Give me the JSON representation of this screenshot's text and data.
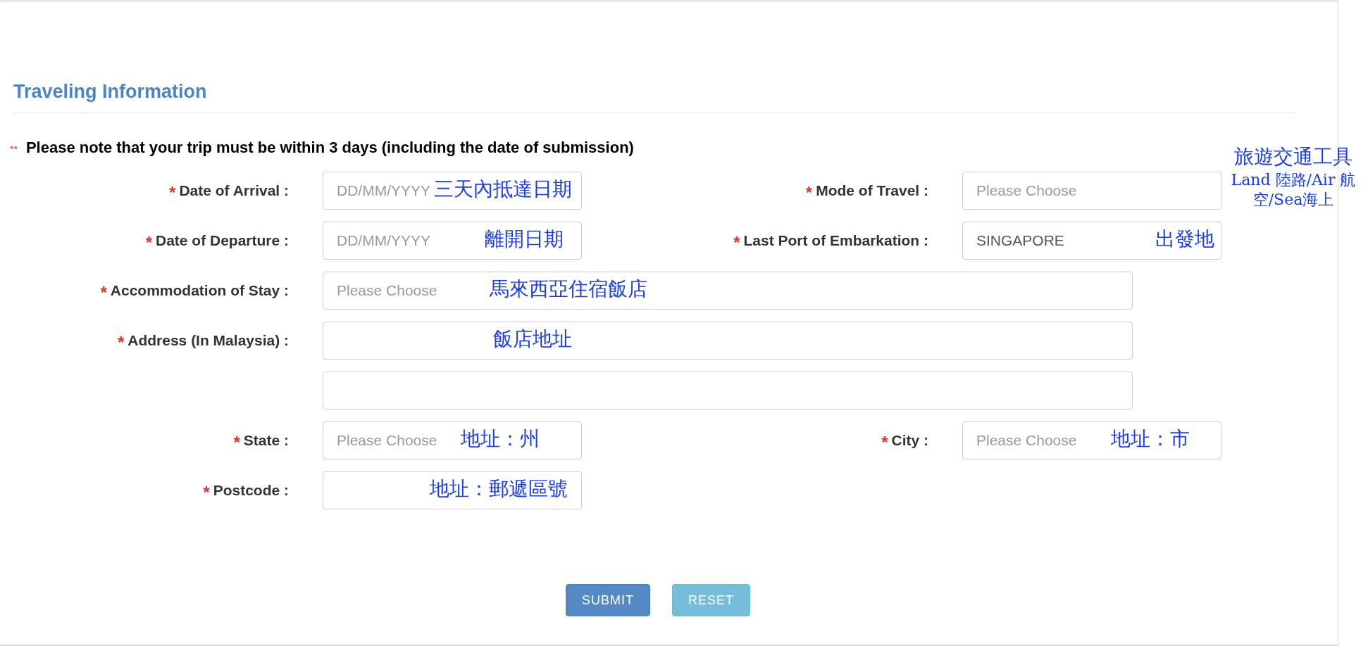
{
  "section": {
    "title": "Traveling Information"
  },
  "note": {
    "marker": "**",
    "text": "Please note that your trip must be within 3 days (including the date of submission)"
  },
  "rows": [
    {
      "fields": [
        {
          "marker": "*",
          "label": "Date of Arrival :",
          "placeholder": "DD/MM/YYYY",
          "annotations": [
            "三天內抵達日期"
          ]
        },
        {
          "marker": "*",
          "label": "Mode of Travel :",
          "placeholder": "Please Choose",
          "annotations": [
            "旅遊交通工具",
            "Land 陸路/Air 航空/Sea海上"
          ]
        }
      ]
    },
    {
      "fields": [
        {
          "marker": "*",
          "label": "Date of Departure :",
          "placeholder": "DD/MM/YYYY",
          "annotations": [
            "離開日期"
          ]
        },
        {
          "marker": "*",
          "label": "Last Port of Embarkation :",
          "value": "SINGAPORE",
          "annotations": [
            "出發地"
          ]
        }
      ]
    },
    {
      "fields": [
        {
          "marker": "*",
          "label": "Accommodation of Stay :",
          "placeholder": "Please Choose",
          "annotations": [
            "馬來西亞住宿飯店"
          ]
        }
      ]
    },
    {
      "fields": [
        {
          "marker": "*",
          "label": "Address (In Malaysia) :",
          "annotations": [
            "飯店地址"
          ],
          "second_line": true
        }
      ]
    },
    {
      "fields": [
        {
          "marker": "*",
          "label": "State :",
          "placeholder": "Please Choose",
          "annotations": [
            "地址：州"
          ]
        },
        {
          "marker": "*",
          "label": "City :",
          "placeholder": "Please Choose",
          "annotations": [
            "地址：市"
          ]
        }
      ]
    },
    {
      "fields": [
        {
          "marker": "*",
          "label": "Postcode :",
          "annotations": [
            "地址：郵遞區號"
          ]
        }
      ]
    }
  ],
  "buttons": [
    {
      "kind": "primary",
      "label": "SUBMIT"
    },
    {
      "kind": "secondary",
      "label": "RESET"
    }
  ]
}
